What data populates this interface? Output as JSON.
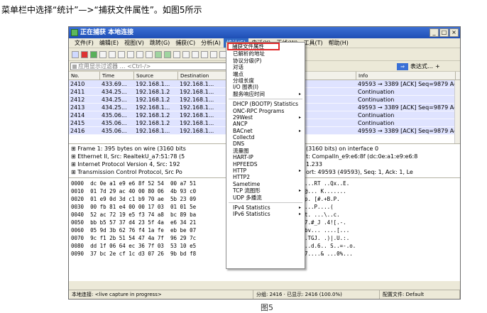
{
  "intro_text": "菜单栏中选择“统计”—>“捕获文件属性”。如图5所示",
  "caption": "图5",
  "window": {
    "title": "正在捕获 本地连接",
    "btn_min": "_",
    "btn_max": "□",
    "btn_close": "×"
  },
  "menubar": [
    "文件(F)",
    "编辑(E)",
    "视图(V)",
    "跳转(G)",
    "捕获(C)",
    "分析(A)",
    "统计(S)",
    "电话(Y)",
    "无线(W)",
    "工具(T)",
    "帮助(H)"
  ],
  "filter": {
    "placeholder": "应用显示过滤器 … <Ctrl-/>",
    "arrow": "⇒",
    "expr_label": "表达式…",
    "plus": "+"
  },
  "columns": [
    "No.",
    "Time",
    "Source",
    "Destination",
    "",
    "Info"
  ],
  "packets": [
    {
      "no": "2410",
      "time": "433.69...",
      "src": "192.168.1...",
      "dst": "192.168.1...",
      "info": "49593 → 3389 [ACK] Seq=9879 Ack=13931"
    },
    {
      "no": "2411",
      "time": "434.25...",
      "src": "192.168.1.2",
      "dst": "192.168.1...",
      "info": "Continuation"
    },
    {
      "no": "2412",
      "time": "434.25...",
      "src": "192.168.1.2",
      "dst": "192.168.1...",
      "info": "Continuation"
    },
    {
      "no": "2413",
      "time": "434.25...",
      "src": "192.168.1...",
      "dst": "192.168.1...",
      "info": "49593 → 3389 [ACK] Seq=9879 Ack=13959"
    },
    {
      "no": "2414",
      "time": "435.06...",
      "src": "192.168.1.2",
      "dst": "192.168.1...",
      "info": "Continuation"
    },
    {
      "no": "2415",
      "time": "435.06...",
      "src": "192.168.1.2",
      "dst": "192.168.1...",
      "info": "Continuation"
    },
    {
      "no": "2416",
      "time": "435.06...",
      "src": "192.168.1...",
      "dst": "192.168.1...",
      "info": "49593 → 3389 [ACK] Seq=9879 Ack=13977"
    }
  ],
  "details": [
    "⊞ Frame 1: 395 bytes on wire (3160 bits",
    "⊞ Ethernet II, Src: RealtekU_a7:51:78 (5",
    "⊞ Internet Protocol Version 4, Src: 192",
    "⊞ Transmission Control Protocol, Src Po"
  ],
  "details_right": [
    "(3160 bits) on interface 0",
    "t: CompalIn_e9:e6:8f (dc:0e:a1:e9:e6:8",
    "1.233",
    "ort: 49593 (49593), Seq: 1, Ack: 1, Le"
  ],
  "bytes": [
    "0000  dc 0e a1 e9 e6 8f 52 54  00 a7 51",
    "0010  01 7d 29 ac 40 00 80 06  4b 93 c0",
    "0020  01 e9 0d 3d c1 b9 70 ae  5b 23 09",
    "0030  00 fb 81 e4 00 00 17 03  01 01 5e",
    "0040  52 ac 72 19 e5 f3 74 a8  bc 89 ba",
    "0050  bb b5 57 37 d4 23 5f 4a  e6 34 21",
    "0060  05 9d 3b 62 76 f4 1a fe  eb be 07",
    "0070  9c f1 2b 51 54 47 4a 7f  96 29 7c",
    "0080  dd 1f 06 64 ec 36 7f 03  53 10 e5",
    "0090  37 bc 2e cf 1c d3 07 26  9b bd f8"
  ],
  "bytes_right": [
    "...RT ..Qx..E.",
    "@... K.......",
    "p. [#.+B.P.",
    "...P....(",
    "t. ...\\..c.",
    "7.#_J .4![.-.",
    "bv... ....[...",
    ".TGJ. .)|.U.:.",
    "..d.6.. S..=-.o.",
    "7....& ...0%..."
  ],
  "statusbar": {
    "iface": "本地连接: <live capture in progress>",
    "counts": "分组: 2416 · 已显示: 2416 (100.0%)",
    "profile": "配置文件: Default"
  },
  "stats_menu": {
    "items": [
      {
        "label": "捕获文件属性",
        "highlight": true
      },
      {
        "label": "已解析的地址"
      },
      {
        "label": "协议分级(P)"
      },
      {
        "label": "对话"
      },
      {
        "label": "端点"
      },
      {
        "label": "分组长度"
      },
      {
        "label": "I/O 图表(I)"
      },
      {
        "label": "服务响应时间",
        "sub": "▸"
      },
      {
        "sep": true
      },
      {
        "label": "DHCP (BOOTP) Statistics"
      },
      {
        "label": "ONC-RPC Programs"
      },
      {
        "label": "29West",
        "sub": "▸"
      },
      {
        "label": "ANCP"
      },
      {
        "label": "BACnet",
        "sub": "▸"
      },
      {
        "label": "Collectd"
      },
      {
        "label": "DNS"
      },
      {
        "label": "流量图"
      },
      {
        "label": "HART-IP"
      },
      {
        "label": "HPFEEDS"
      },
      {
        "label": "HTTP",
        "sub": "▸"
      },
      {
        "label": "HTTP2"
      },
      {
        "label": "Sametime"
      },
      {
        "label": "TCP 流图形",
        "sub": "▸"
      },
      {
        "label": "UDP 多播流"
      },
      {
        "sep": true
      },
      {
        "label": "IPv4 Statistics",
        "sub": "▸"
      },
      {
        "label": "IPv6 Statistics",
        "sub": "▸"
      }
    ]
  }
}
